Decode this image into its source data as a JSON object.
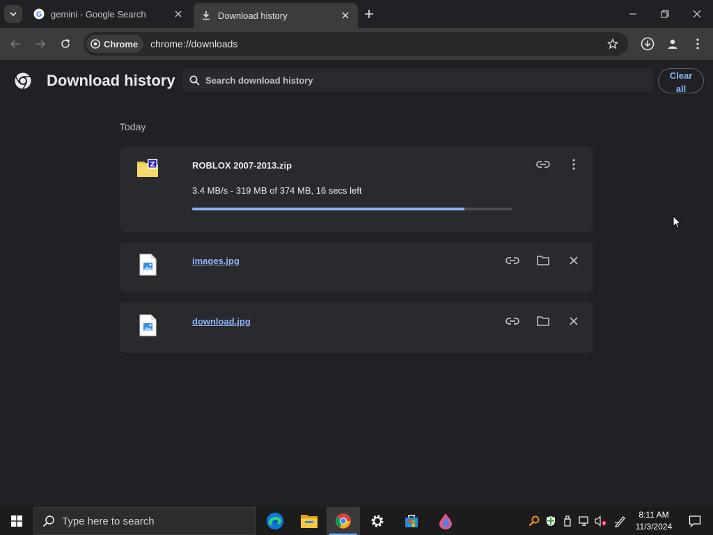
{
  "tabs": [
    {
      "title": "gemini - Google Search",
      "active": false
    },
    {
      "title": "Download history",
      "active": true
    }
  ],
  "omnibox": {
    "chip_label": "Chrome",
    "url": "chrome://downloads"
  },
  "page": {
    "title": "Download history",
    "search_placeholder": "Search download history",
    "clear_all_line1": "Clear",
    "clear_all_line2": "all",
    "section_date": "Today"
  },
  "downloads": [
    {
      "name": "ROBLOX 2007-2013.zip",
      "status": "3.4 MB/s - 319 MB of 374 MB, 16 secs left",
      "progress": 0.85,
      "state": "in-progress",
      "icon": "zip-icon"
    },
    {
      "name": "images.jpg",
      "state": "complete",
      "icon": "image-file-icon"
    },
    {
      "name": "download.jpg",
      "state": "complete",
      "icon": "image-file-icon"
    }
  ],
  "taskbar": {
    "search_placeholder": "Type here to search",
    "time": "8:11 AM",
    "date": "11/3/2024"
  },
  "colors": {
    "accent": "#8ab4f8",
    "background": "#202124",
    "card": "#292a2d"
  }
}
